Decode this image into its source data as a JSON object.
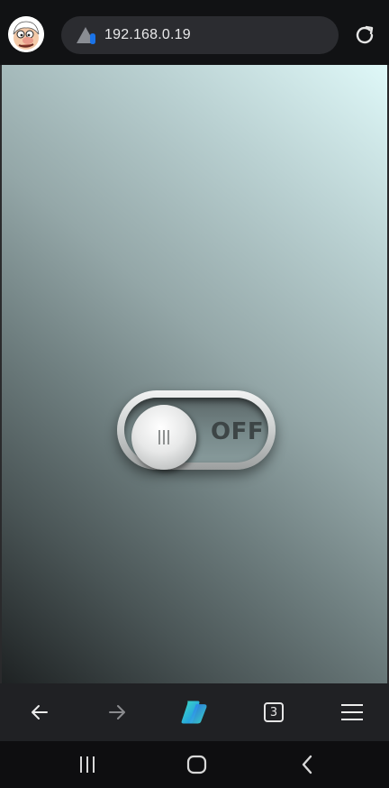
{
  "browser": {
    "url": "192.168.0.19",
    "avatar_icon": "user-avatar-cartoon",
    "security_icon": "not-secure-warning-icon",
    "reload_icon": "reload-icon"
  },
  "page": {
    "toggle_state": "OFF",
    "toggle_on": false,
    "background_colors": [
      "#dff8f8",
      "#94a7a8",
      "#1e2223"
    ]
  },
  "bottom_nav": {
    "back_icon": "arrow-left-icon",
    "forward_icon": "arrow-right-icon",
    "copilot_icon": "copilot-icon",
    "tab_count": "3",
    "menu_icon": "hamburger-menu-icon"
  },
  "system_nav": {
    "recents_icon": "recents-icon",
    "home_icon": "home-icon",
    "back_icon": "back-chevron-icon"
  }
}
